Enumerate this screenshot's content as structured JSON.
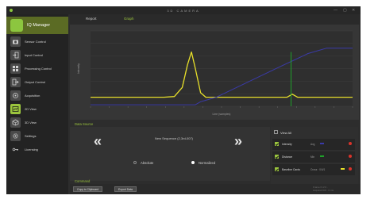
{
  "window": {
    "title": "3D CAMERA",
    "controls": [
      "—",
      "▢",
      "✕"
    ]
  },
  "app": {
    "name": "IQ Manager"
  },
  "sidebar": {
    "items": [
      {
        "label": "Sensor Control",
        "icon": "camera-icon"
      },
      {
        "label": "Input Control",
        "icon": "input-arrow-icon"
      },
      {
        "label": "Processing Control",
        "icon": "processing-grid-icon"
      },
      {
        "label": "Output Control",
        "icon": "output-arrow-icon"
      },
      {
        "label": "Acquisition",
        "icon": "acquisition-icon"
      },
      {
        "label": "2D View",
        "icon": "2d-view-icon",
        "active": true
      },
      {
        "label": "3D View",
        "icon": "3d-view-icon"
      },
      {
        "label": "Settings",
        "icon": "gear-icon"
      },
      {
        "label": "Licensing",
        "icon": "key-icon"
      }
    ]
  },
  "tabs": [
    {
      "label": "Report",
      "active": false
    },
    {
      "label": "Graph",
      "active": true
    }
  ],
  "colors": {
    "accent": "#9bc53d",
    "series_yellow": "#e8e02a",
    "series_blue": "#3a3aa8",
    "series_green": "#1fa02a",
    "remove": "#d9342b"
  },
  "chart_data": {
    "type": "line",
    "xlabel": "Line (samples)",
    "ylabel": "Intensity",
    "series": [
      {
        "color": "#e8e02a",
        "points": [
          [
            0,
            0.12
          ],
          [
            0.2,
            0.12
          ],
          [
            0.28,
            0.12
          ],
          [
            0.32,
            0.13
          ],
          [
            0.35,
            0.25
          ],
          [
            0.37,
            0.55
          ],
          [
            0.385,
            0.72
          ],
          [
            0.4,
            0.5
          ],
          [
            0.42,
            0.18
          ],
          [
            0.44,
            0.12
          ],
          [
            0.55,
            0.12
          ],
          [
            0.75,
            0.12
          ],
          [
            0.77,
            0.16
          ],
          [
            0.79,
            0.12
          ],
          [
            1,
            0.12
          ]
        ]
      },
      {
        "color": "#3a3aa8",
        "points": [
          [
            0,
            0.02
          ],
          [
            0.4,
            0.02
          ],
          [
            0.42,
            0.06
          ],
          [
            0.48,
            0.12
          ],
          [
            0.6,
            0.32
          ],
          [
            0.72,
            0.52
          ],
          [
            0.83,
            0.7
          ],
          [
            0.9,
            0.77
          ],
          [
            1,
            0.77
          ]
        ]
      },
      {
        "color": "#1fa02a",
        "points": [
          [
            0.765,
            0.0
          ],
          [
            0.765,
            0.72
          ]
        ]
      }
    ],
    "grid": true,
    "legend": "none"
  },
  "data_source": {
    "title": "Data Source",
    "prev": "«",
    "next": "»",
    "name": "New Sequence (2,3rd-007)",
    "radios": [
      {
        "label": "Absolute",
        "selected": false
      },
      {
        "label": "Normalized",
        "selected": true
      }
    ]
  },
  "list": {
    "view_all": "View All",
    "rows": [
      {
        "name": "Intensity",
        "suffix": "Avg",
        "swatch": "#3a3aa8",
        "checked": true
      },
      {
        "name": "Distance",
        "suffix": "Min",
        "swatch": "#1fa02a",
        "checked": true
      },
      {
        "name": "Baseline Cards",
        "suffix": "Cross · 0/4/1",
        "swatch": "#e8e02a",
        "checked": true
      }
    ]
  },
  "command": {
    "title": "Command",
    "buttons": [
      "Copy to Clipboard",
      "Export Data"
    ],
    "status": [
      "Frame 0 of 0 ·",
      "Acquired 0/0 · 0 ms"
    ]
  }
}
